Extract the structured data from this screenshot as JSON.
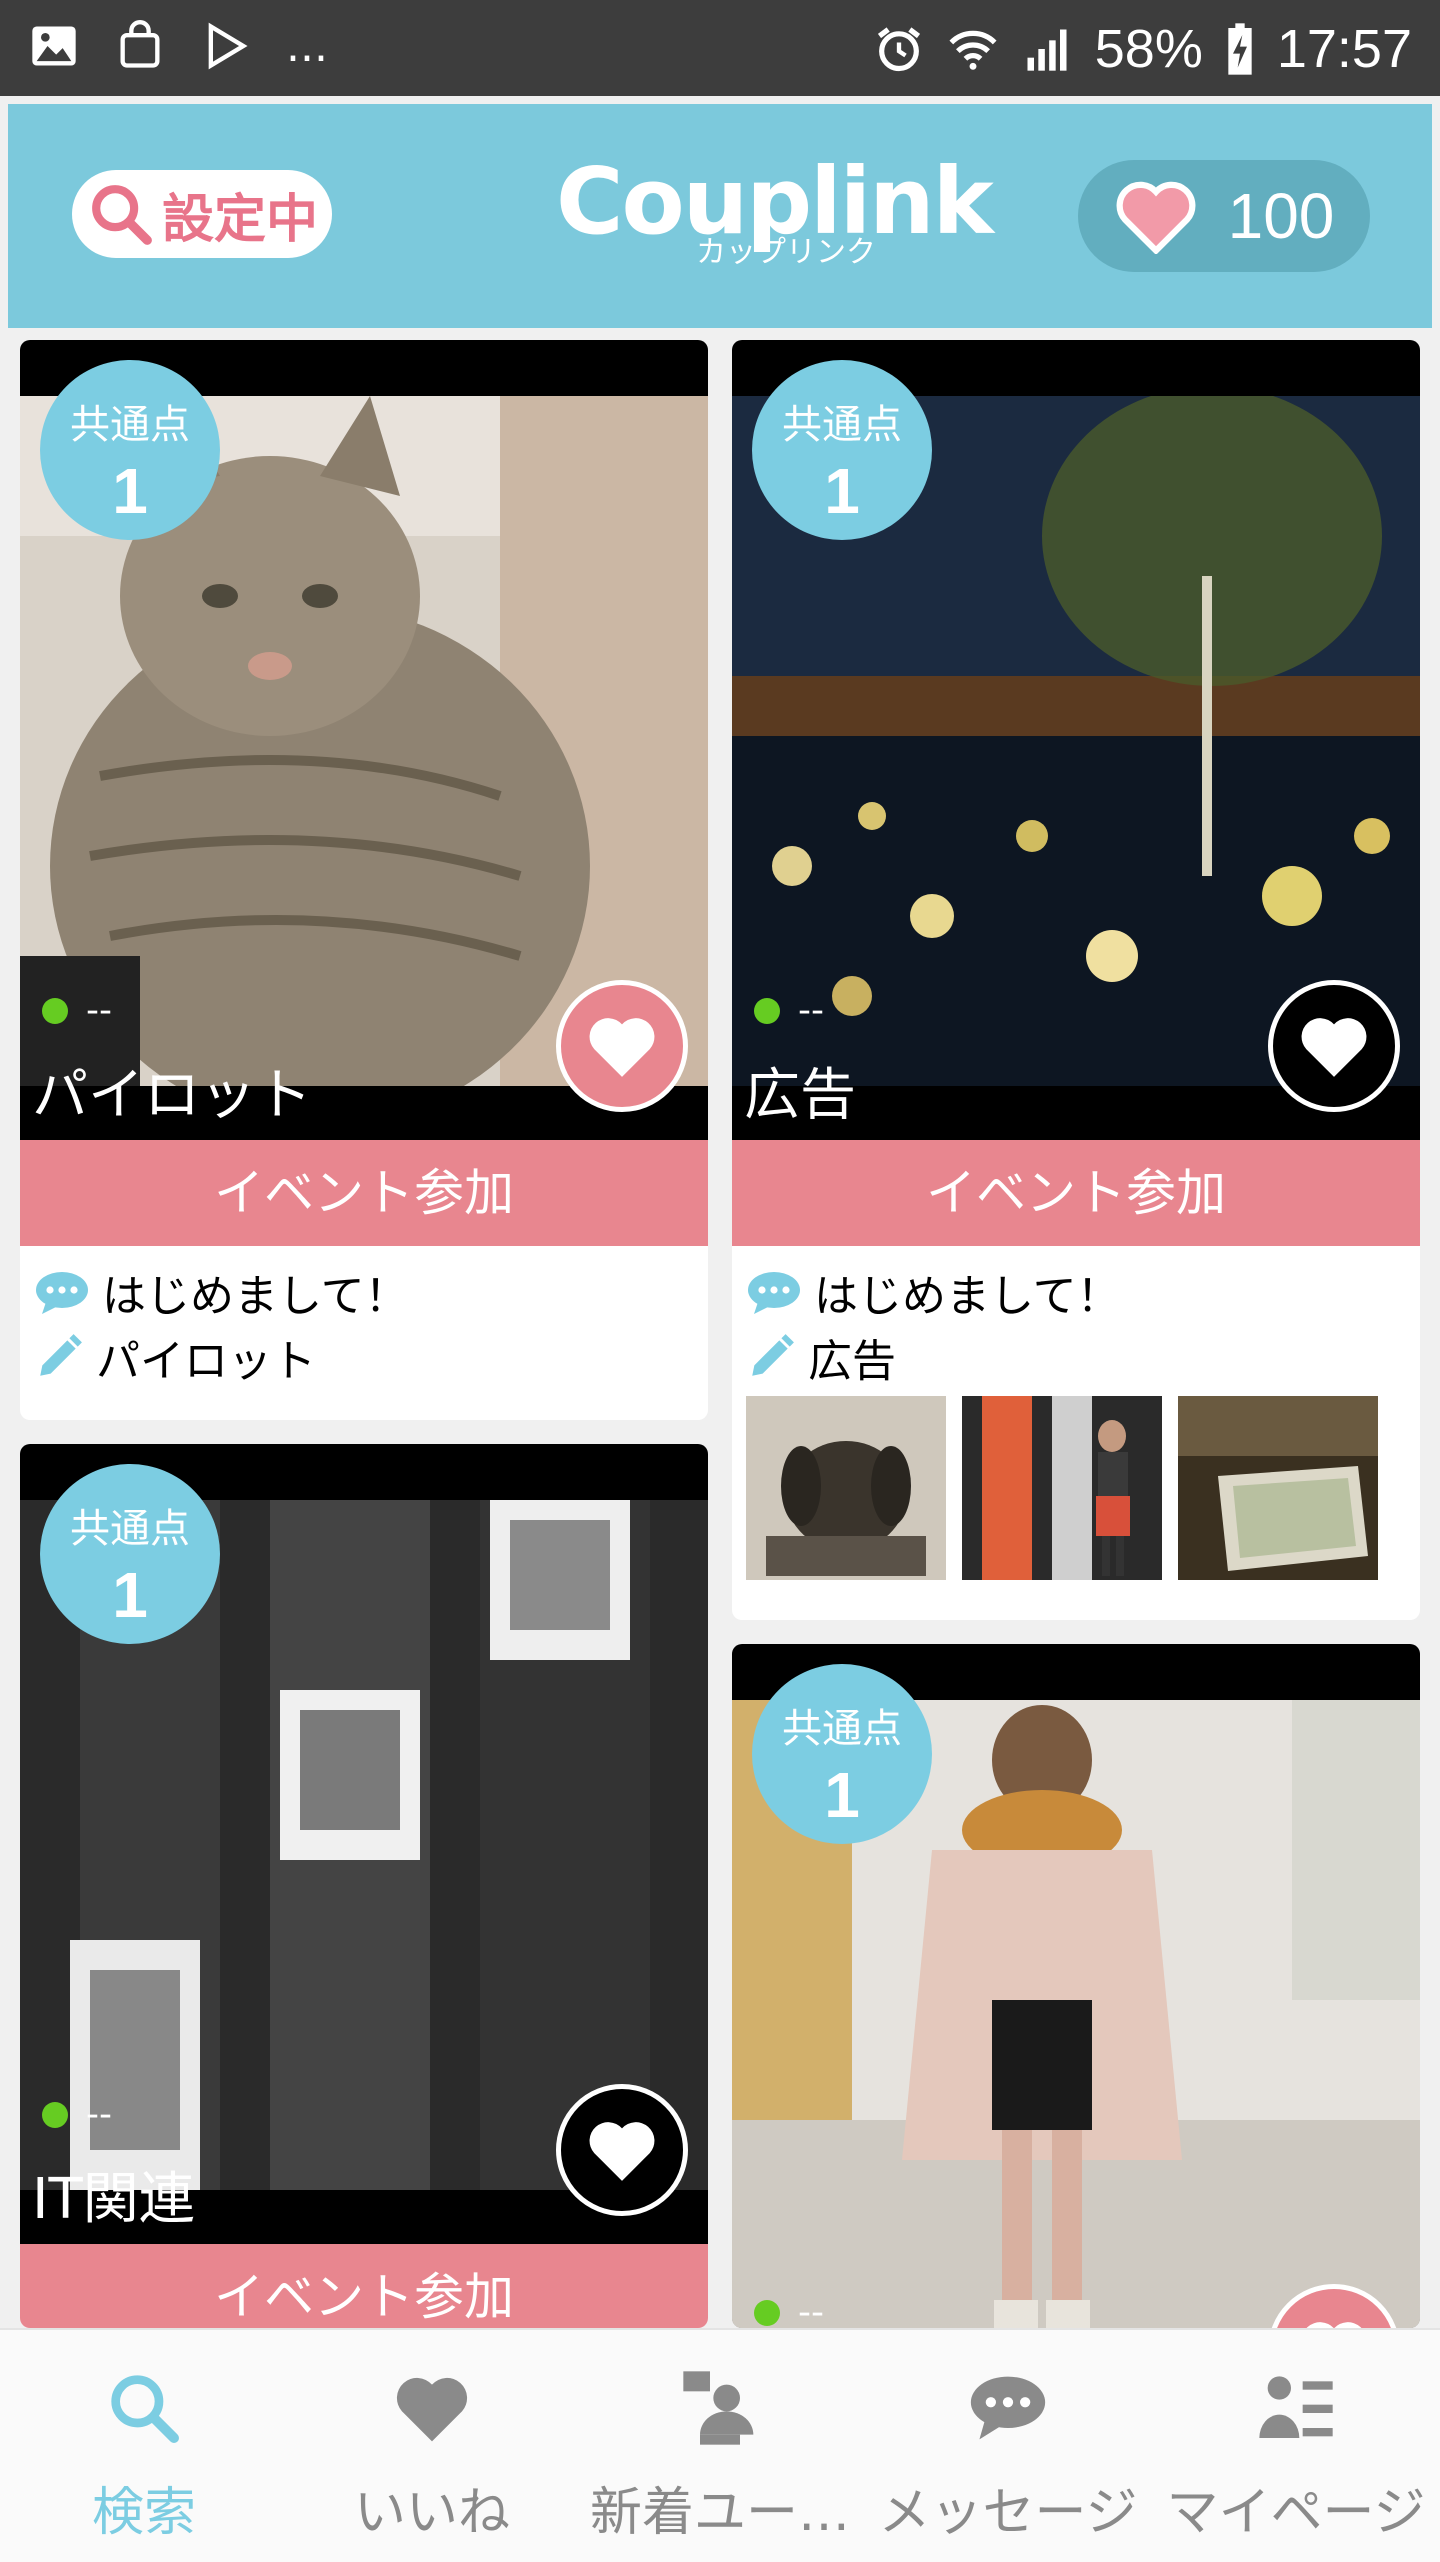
{
  "status_bar": {
    "left_icons": [
      "image-icon",
      "shopping-bag-icon",
      "play-store-icon"
    ],
    "more": "...",
    "battery": "58%",
    "time": "17:57"
  },
  "header": {
    "search_label": "設定中",
    "logo_text": "Couplink",
    "logo_sub": "カップリンク",
    "likes_count": "100"
  },
  "cards": [
    {
      "common_label": "共通点",
      "common_count": "1",
      "status": "--",
      "name": "パイロット",
      "liked": true,
      "event_label": "イベント参加",
      "message": "はじめまして！",
      "description": "パイロット"
    },
    {
      "common_label": "共通点",
      "common_count": "1",
      "status": "--",
      "name": "広告",
      "liked": false,
      "event_label": "イベント参加",
      "message": "はじめまして！",
      "description": "広告"
    },
    {
      "common_label": "共通点",
      "common_count": "1",
      "status": "--",
      "name": "IT関連",
      "liked": false,
      "event_label": "イベント参加"
    },
    {
      "common_label": "共通点",
      "common_count": "1",
      "status": "--",
      "liked": true
    }
  ],
  "bottom_nav": {
    "items": [
      {
        "label": "検索",
        "icon": "search-icon",
        "active": true
      },
      {
        "label": "いいね",
        "icon": "heart-icon",
        "active": false
      },
      {
        "label": "新着ユー…",
        "icon": "new-user-icon",
        "active": false
      },
      {
        "label": "メッセージ",
        "icon": "message-icon",
        "active": false
      },
      {
        "label": "マイページ",
        "icon": "profile-icon",
        "active": false
      }
    ]
  },
  "colors": {
    "accent": "#7cc9dc",
    "pink": "#e8868f",
    "badge": "#7ccde2",
    "online": "#66cc22"
  }
}
